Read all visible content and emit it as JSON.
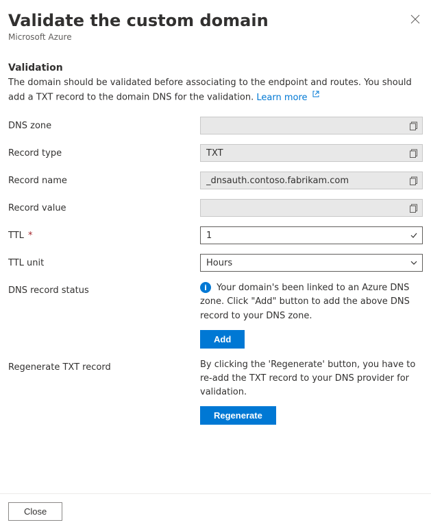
{
  "header": {
    "title": "Validate the custom domain",
    "subtitle": "Microsoft Azure"
  },
  "validation": {
    "section_title": "Validation",
    "description_prefix": "The domain should be validated before associating to the endpoint and routes. You should add a TXT record to the domain DNS for the validation. ",
    "learn_more": "Learn more"
  },
  "fields": {
    "dns_zone": {
      "label": "DNS zone",
      "value": ""
    },
    "record_type": {
      "label": "Record type",
      "value": "TXT"
    },
    "record_name": {
      "label": "Record name",
      "value": "_dnsauth.contoso.fabrikam.com"
    },
    "record_value": {
      "label": "Record value",
      "value": ""
    },
    "ttl": {
      "label": "TTL",
      "value": "1"
    },
    "ttl_unit": {
      "label": "TTL unit",
      "value": "Hours"
    }
  },
  "status": {
    "label": "DNS record status",
    "message": "Your domain's been linked to an Azure DNS zone. Click \"Add\" button to add the above DNS record to your DNS zone.",
    "add_button": "Add"
  },
  "regenerate": {
    "label": "Regenerate TXT record",
    "message": "By clicking the 'Regenerate' button, you have to re-add the TXT record to your DNS provider for validation.",
    "button": "Regenerate"
  },
  "footer": {
    "close": "Close"
  }
}
